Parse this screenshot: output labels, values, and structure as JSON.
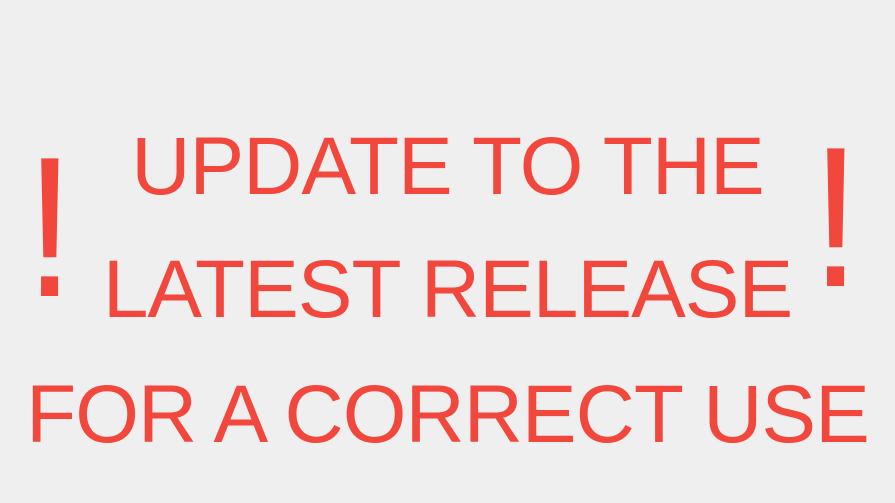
{
  "notice": {
    "mark_left": "!",
    "mark_right": "!",
    "lines": [
      "UPDATE TO THE",
      "LATEST RELEASE",
      "FOR A CORRECT USE"
    ]
  },
  "colors": {
    "background": "#efefef",
    "text": "#f2473c"
  }
}
